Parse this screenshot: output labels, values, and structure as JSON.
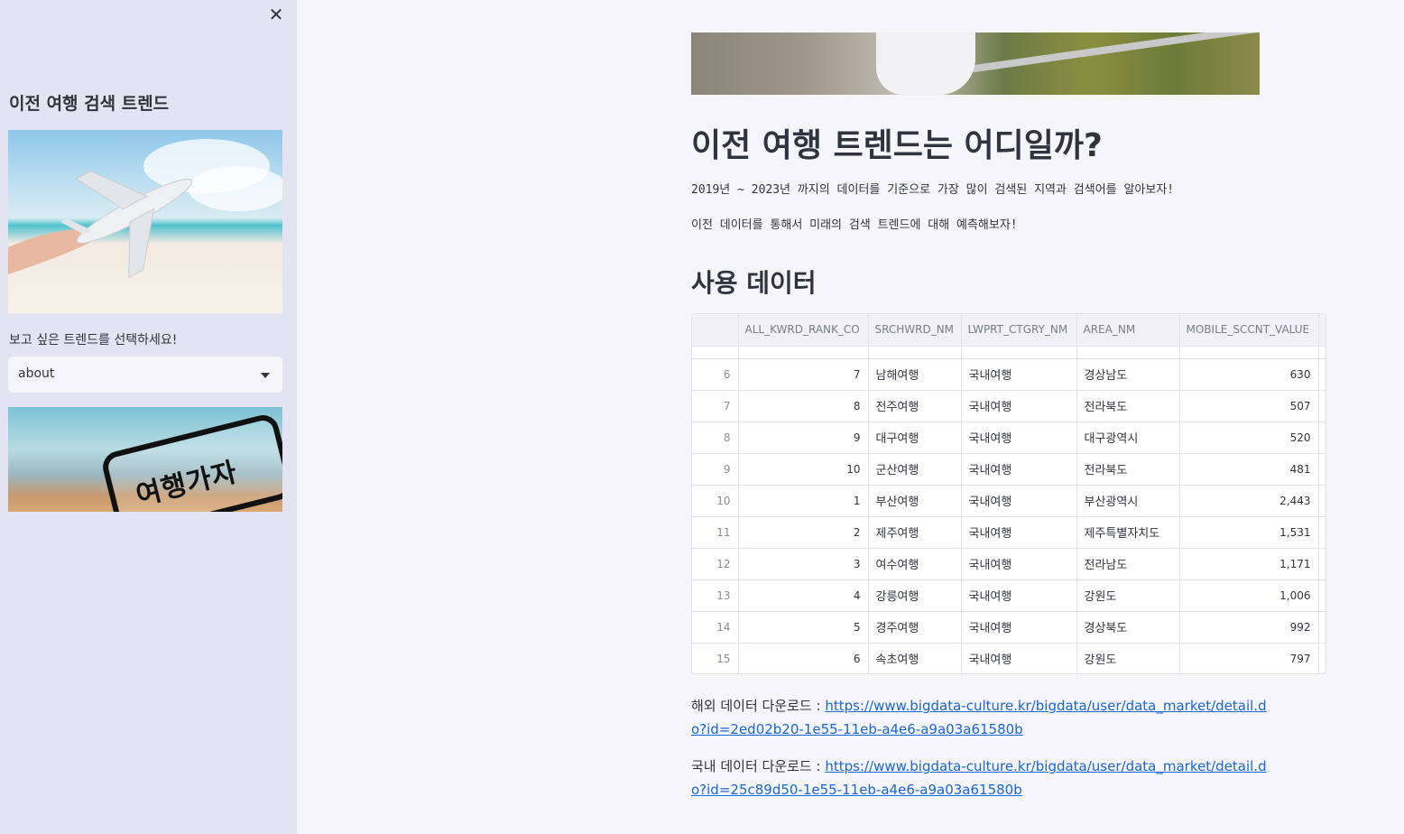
{
  "sidebar": {
    "close_icon": "close-icon",
    "title": "이전 여행 검색 트렌드",
    "select_label": "보고 싶은 트렌드를 선택하세요!",
    "select_value": "about",
    "ticket_text": "여행가자"
  },
  "main": {
    "title": "이전 여행 트렌드는 어디일까?",
    "paragraph1": "2019년 ~ 2023년 까지의 데이터를 기준으로 가장 많이 검색된 지역과 검색어를 알아보자!",
    "paragraph2": "이전 데이터를 통해서 미래의 검색 트렌드에 대해 예측해보자!",
    "section_title": "사용 데이터",
    "table": {
      "columns": [
        "",
        "ALL_KWRD_RANK_CO",
        "SRCHWRD_NM",
        "LWPRT_CTGRY_NM",
        "AREA_NM",
        "MOBILE_SCCNT_VALUE",
        ""
      ],
      "rows": [
        [
          "6",
          "7",
          "남해여행",
          "국내여행",
          "경상남도",
          "630"
        ],
        [
          "7",
          "8",
          "전주여행",
          "국내여행",
          "전라북도",
          "507"
        ],
        [
          "8",
          "9",
          "대구여행",
          "국내여행",
          "대구광역시",
          "520"
        ],
        [
          "9",
          "10",
          "군산여행",
          "국내여행",
          "전라북도",
          "481"
        ],
        [
          "10",
          "1",
          "부산여행",
          "국내여행",
          "부산광역시",
          "2,443"
        ],
        [
          "11",
          "2",
          "제주여행",
          "국내여행",
          "제주특별자치도",
          "1,531"
        ],
        [
          "12",
          "3",
          "여수여행",
          "국내여행",
          "전라남도",
          "1,171"
        ],
        [
          "13",
          "4",
          "강릉여행",
          "국내여행",
          "강원도",
          "1,006"
        ],
        [
          "14",
          "5",
          "경주여행",
          "국내여행",
          "경상북도",
          "992"
        ],
        [
          "15",
          "6",
          "속초여행",
          "국내여행",
          "강원도",
          "797"
        ]
      ]
    },
    "download1_label": "해외 데이터 다운로드 : ",
    "download1_link": "https://www.bigdata-culture.kr/bigdata/user/data_market/detail.do?id=2ed02b20-1e55-11eb-a4e6-a9a03a61580b",
    "download2_label": "국내 데이터 다운로드 : ",
    "download2_link": "https://www.bigdata-culture.kr/bigdata/user/data_market/detail.do?id=25c89d50-1e55-11eb-a4e6-a9a03a61580b"
  }
}
